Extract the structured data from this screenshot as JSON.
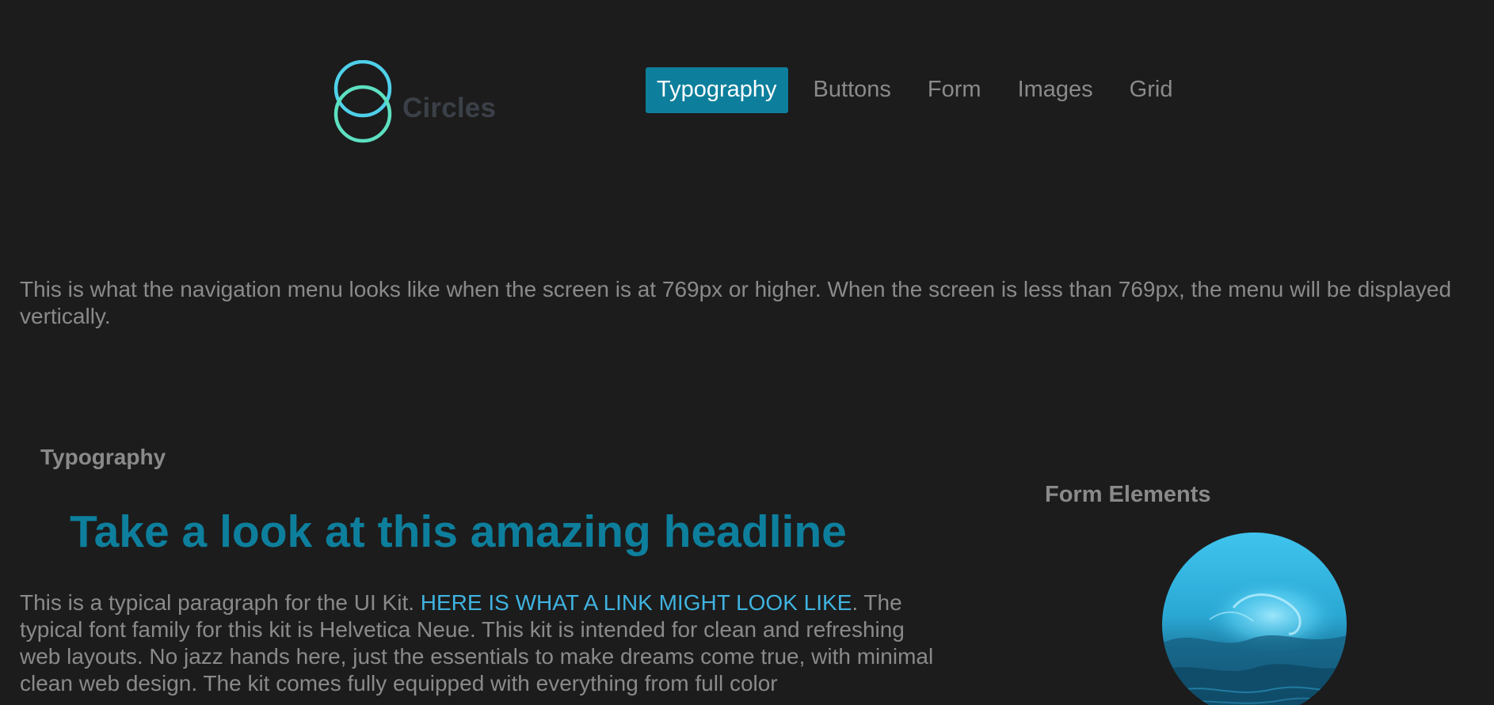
{
  "header": {
    "logo_text": "Circles",
    "nav": [
      {
        "label": "Typography",
        "active": true
      },
      {
        "label": "Buttons",
        "active": false
      },
      {
        "label": "Form",
        "active": false
      },
      {
        "label": "Images",
        "active": false
      },
      {
        "label": "Grid",
        "active": false
      }
    ]
  },
  "intro": {
    "text": "This is what the navigation menu looks like when the screen is at 769px or higher. When the screen is less than 769px, the menu will be displayed vertically."
  },
  "typography": {
    "section_label": "Typography",
    "headline": "Take a look at this amazing headline",
    "para_start": "This is a typical paragraph for the UI Kit. ",
    "link_text": "HERE IS WHAT A LINK MIGHT LOOK LIKE",
    "para_rest": ". The typical font family for this kit is Helvetica Neue. This kit is intended for clean and refreshing web layouts. No jazz hands here, just the essentials to make dreams come true, with minimal clean web design. The kit comes fully equipped with everything from full color"
  },
  "sidebar": {
    "form_elements_label": "Form Elements",
    "image_icon": "wave-image"
  },
  "colors": {
    "background": "#1c1c1c",
    "accent": "#0d7f9c",
    "link": "#3fb3e0",
    "text": "#8a8a8a",
    "logo_ring_top": "#4fd0ea",
    "logo_ring_bottom": "#5de0c0"
  }
}
